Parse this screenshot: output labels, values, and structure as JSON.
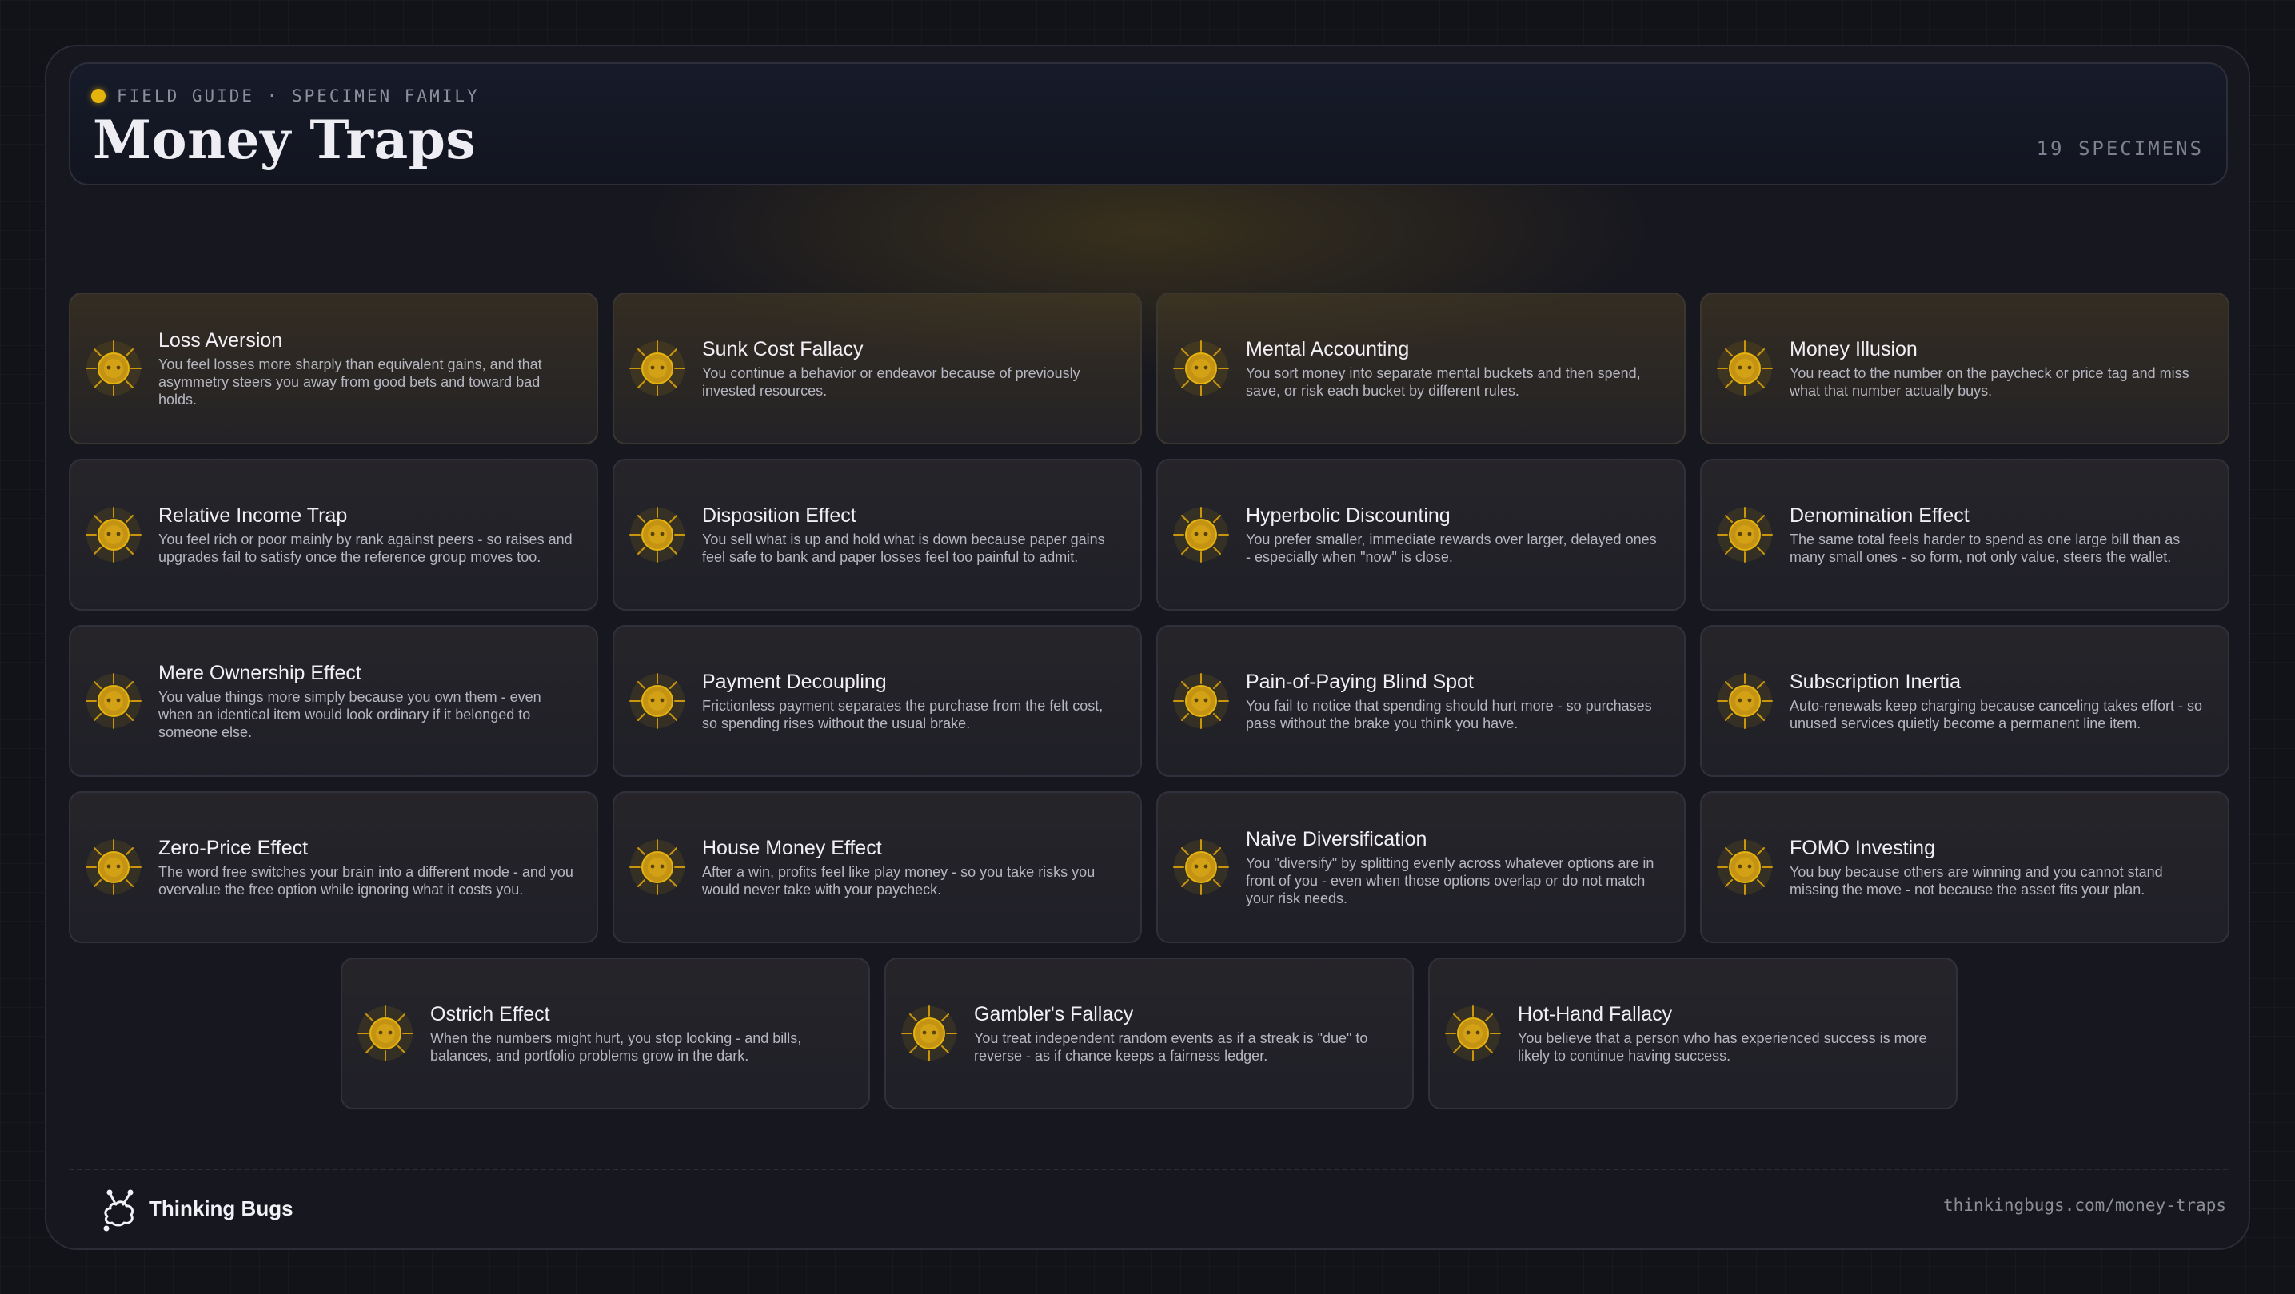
{
  "header": {
    "eyebrow": "FIELD GUIDE · SPECIMEN FAMILY",
    "title": "Money Traps",
    "count": "19 SPECIMENS"
  },
  "accent_color": "#e5b30e",
  "icon": "bug-specimen-icon",
  "cards": [
    {
      "name": "Loss Aversion",
      "desc": "You feel losses more sharply than equivalent gains, and that asymmetry steers you away from good bets and toward bad holds."
    },
    {
      "name": "Sunk Cost Fallacy",
      "desc": "You continue a behavior or endeavor because of previously invested resources."
    },
    {
      "name": "Mental Accounting",
      "desc": "You sort money into separate mental buckets and then spend, save, or risk each bucket by different rules."
    },
    {
      "name": "Money Illusion",
      "desc": "You react to the number on the paycheck or price tag and miss what that number actually buys."
    },
    {
      "name": "Relative Income Trap",
      "desc": "You feel rich or poor mainly by rank against peers - so raises and upgrades fail to satisfy once the reference group moves too."
    },
    {
      "name": "Disposition Effect",
      "desc": "You sell what is up and hold what is down because paper gains feel safe to bank and paper losses feel too painful to admit."
    },
    {
      "name": "Hyperbolic Discounting",
      "desc": "You prefer smaller, immediate rewards over larger, delayed ones - especially when \"now\" is close."
    },
    {
      "name": "Denomination Effect",
      "desc": "The same total feels harder to spend as one large bill than as many small ones - so form, not only value, steers the wallet."
    },
    {
      "name": "Mere Ownership Effect",
      "desc": "You value things more simply because you own them - even when an identical item would look ordinary if it belonged to someone else."
    },
    {
      "name": "Payment Decoupling",
      "desc": "Frictionless payment separates the purchase from the felt cost, so spending rises without the usual brake."
    },
    {
      "name": "Pain-of-Paying Blind Spot",
      "desc": "You fail to notice that spending should hurt more - so purchases pass without the brake you think you have."
    },
    {
      "name": "Subscription Inertia",
      "desc": "Auto-renewals keep charging because canceling takes effort - so unused services quietly become a permanent line item."
    },
    {
      "name": "Zero-Price Effect",
      "desc": "The word free switches your brain into a different mode - and you overvalue the free option while ignoring what it costs you."
    },
    {
      "name": "House Money Effect",
      "desc": "After a win, profits feel like play money - so you take risks you would never take with your paycheck."
    },
    {
      "name": "Naive Diversification",
      "desc": "You \"diversify\" by splitting evenly across whatever options are in front of you - even when those options overlap or do not match your risk needs."
    },
    {
      "name": "FOMO Investing",
      "desc": "You buy because others are winning and you cannot stand missing the move - not because the asset fits your plan."
    },
    {
      "name": "Ostrich Effect",
      "desc": "When the numbers might hurt, you stop looking - and bills, balances, and portfolio problems grow in the dark."
    },
    {
      "name": "Gambler's Fallacy",
      "desc": "You treat independent random events as if a streak is \"due\" to reverse - as if chance keeps a fairness ledger."
    },
    {
      "name": "Hot-Hand Fallacy",
      "desc": "You believe that a person who has experienced success is more likely to continue having success."
    }
  ],
  "footer": {
    "brand": "Thinking Bugs",
    "brand_icon": "thinking-bugs-logo-icon",
    "url": "thinkingbugs.com/money-traps"
  }
}
